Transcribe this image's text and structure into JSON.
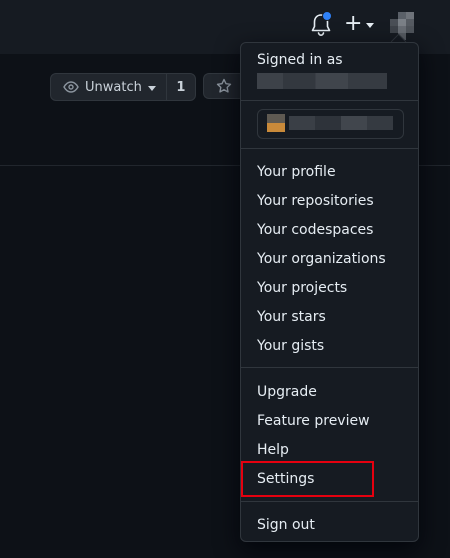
{
  "repo_actions": {
    "unwatch_label": "Unwatch",
    "watch_count": "1"
  },
  "header": {
    "notification_icon": "bell-icon",
    "create_icon": "plus-icon",
    "accent": "#2f81f7"
  },
  "user_menu": {
    "signed_in_label": "Signed in as",
    "items_group_1": [
      "Your profile",
      "Your repositories",
      "Your codespaces",
      "Your organizations",
      "Your projects",
      "Your stars",
      "Your gists"
    ],
    "items_group_2": [
      "Upgrade",
      "Feature preview",
      "Help",
      "Settings"
    ],
    "sign_out": "Sign out",
    "highlight_color": "#e5000f"
  }
}
